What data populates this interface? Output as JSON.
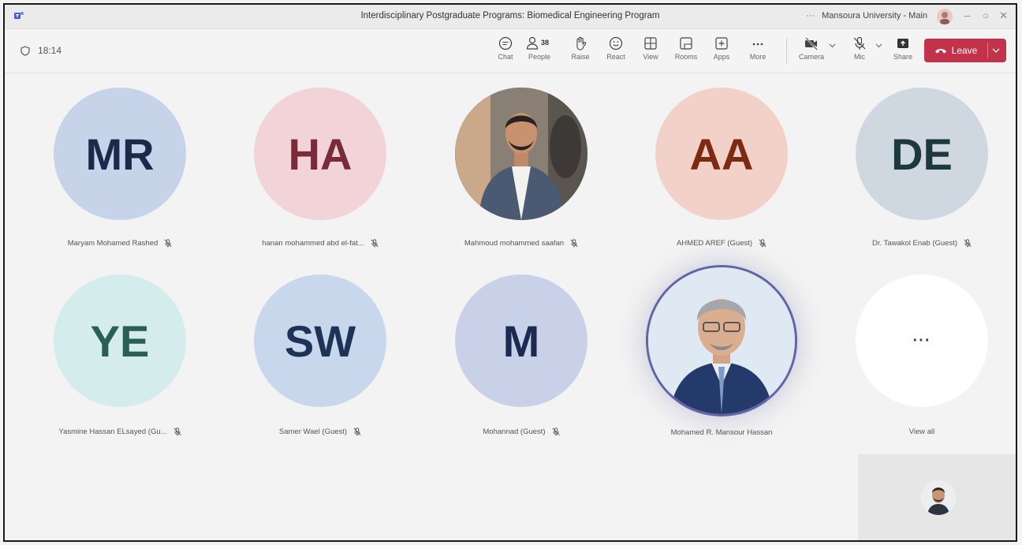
{
  "window": {
    "title": "Interdisciplinary Postgraduate Programs: Biomedical Engineering Program",
    "org": "Mansoura University - Main",
    "org_dots": "···",
    "minimize": "–",
    "restore": "○",
    "close": "✕"
  },
  "toolbar": {
    "timer": "18:14",
    "chat": "Chat",
    "people": "People",
    "people_count": "38",
    "raise": "Raise",
    "react": "React",
    "view": "View",
    "rooms": "Rooms",
    "apps": "Apps",
    "more": "More",
    "camera": "Camera",
    "mic": "Mic",
    "share": "Share",
    "leave": "Leave"
  },
  "participants": [
    {
      "initials": "MR",
      "name": "Maryam Mohamed Rashed",
      "bg": "#c7d3e8",
      "fg": "#1b2a4a",
      "muted": true
    },
    {
      "initials": "HA",
      "name": "hanan mohammed abd el-fat...",
      "bg": "#f1d3d8",
      "fg": "#7a2b3a",
      "muted": true
    },
    {
      "initials": "",
      "name": "Mahmoud mohammed saafan",
      "photo": true,
      "muted": true
    },
    {
      "initials": "AA",
      "name": "AHMED AREF (Guest)",
      "bg": "#f2d2c8",
      "fg": "#7d2a14",
      "muted": true
    },
    {
      "initials": "DE",
      "name": "Dr. Tawakol Enab (Guest)",
      "bg": "#cfd8e0",
      "fg": "#1e3840",
      "muted": true
    },
    {
      "initials": "YE",
      "name": "Yasmine Hassan ELsayed (Gu...",
      "bg": "#d5ecec",
      "fg": "#2a5f55",
      "muted": true
    },
    {
      "initials": "SW",
      "name": "Samer Wael (Guest)",
      "bg": "#c9d7ec",
      "fg": "#1d3456",
      "muted": true
    },
    {
      "initials": "M",
      "name": "Mohannad (Guest)",
      "bg": "#c8d1e8",
      "fg": "#1a2a52",
      "muted": true
    },
    {
      "initials": "",
      "name": "Mohamed R. Mansour Hassan",
      "photo": true,
      "speaking": true,
      "muted": false
    },
    {
      "initials": "···",
      "name": "View all",
      "viewall": true,
      "muted": false
    }
  ],
  "colors": {
    "accent": "#6264a7",
    "leave": "#c4314b"
  }
}
